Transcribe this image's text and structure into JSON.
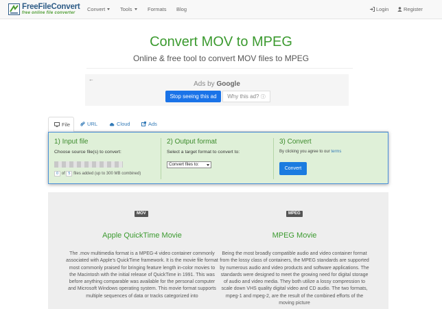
{
  "brand": {
    "title": "FreeFileConvert",
    "subtitle": "free online file converter"
  },
  "nav": {
    "convert": "Convert",
    "tools": "Tools",
    "formats": "Formats",
    "blog": "Blog",
    "login": "Login",
    "register": "Register"
  },
  "hero": {
    "title": "Convert MOV to MPEG",
    "subtitle": "Online & free tool to convert MOV files to MPEG"
  },
  "ad": {
    "back": "←",
    "ads_by": "Ads by",
    "google": "Google",
    "stop": "Stop seeing this ad",
    "why": "Why this ad?"
  },
  "tabs": [
    {
      "label": "File",
      "icon": "monitor-icon"
    },
    {
      "label": "URL",
      "icon": "link-icon"
    },
    {
      "label": "Cloud",
      "icon": "cloud-icon"
    },
    {
      "label": "Ads",
      "icon": "external-link-icon"
    }
  ],
  "steps": {
    "input": {
      "title": "1) Input file",
      "text": "Choose source file(s) to convert:",
      "files_count": "0",
      "files_max": "5",
      "files_text": "files added (up to 300 MB combined)",
      "of": "of"
    },
    "output": {
      "title": "2) Output format",
      "text": "Select a target format to convert to:",
      "select_value": "Convert files to:"
    },
    "convert": {
      "title": "3) Convert",
      "agree_text": "By clicking you agree to our",
      "terms": "terms",
      "button": "Convert"
    }
  },
  "formats": {
    "source": {
      "badge": "MOV",
      "title": "Apple QuickTime Movie",
      "description": "The .mov multimedia format is a MPEG-4 video container commonly associated with Apple's QuickTime framework. It is the movie file format most commonly praised for bringing feature length in-color movies to the Macintosh with the initial release of QuickTime in 1991. This was before anything comparable was available for the personal computer and Microsoft Windows operating system. This movie format supports multiple sequences of data or tracks categorized into"
    },
    "target": {
      "badge": "MPEG",
      "title": "MPEG Movie",
      "description": "Being the most broadly compatible audio and video container format from the lossy class of containers, the MPEG standards are supported by numerous audio and video products and software applications. The standards were designed to meet the growing need for digital storage of audio and video media. They both utilize a lossy compression to scale down VHS quality digital video and CD audio. The two formats, mpeg-1 and mpeg-2, are the result of the combined efforts of the moving picture"
    }
  },
  "colors": {
    "accent": "#3b9a2f",
    "brand": "#2d5b86",
    "primary": "#1a7be0",
    "panel_bg": "#dff0d8"
  }
}
